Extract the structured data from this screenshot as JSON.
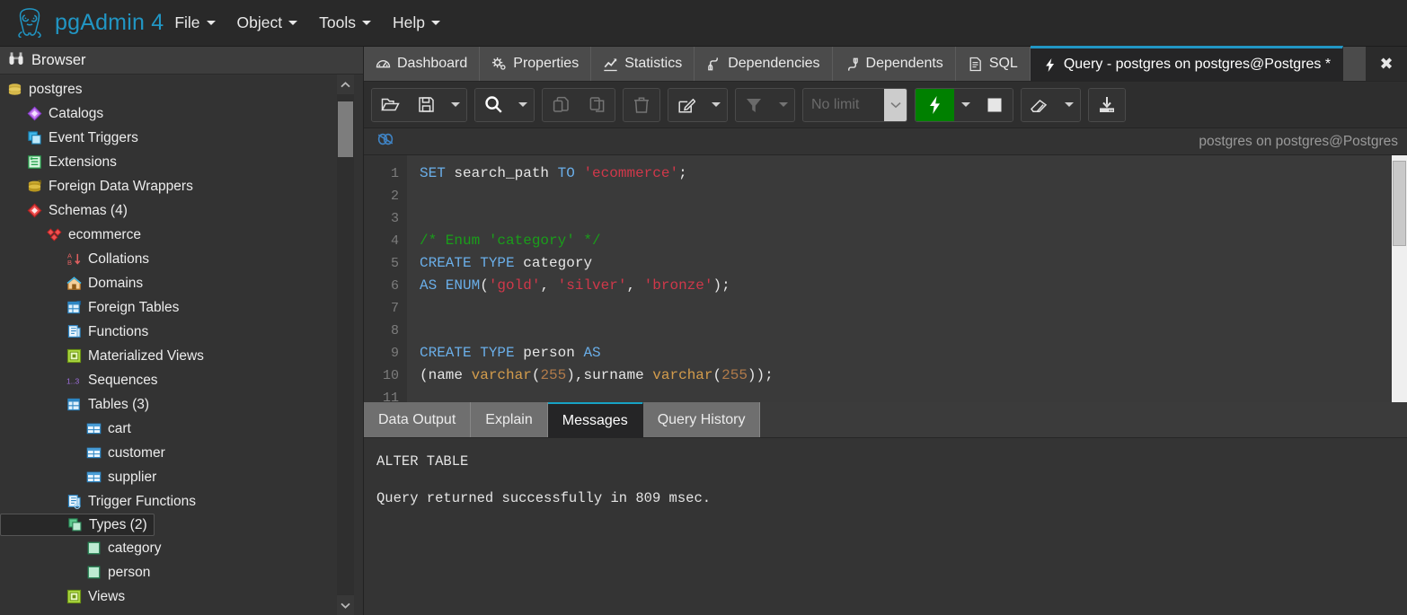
{
  "app": {
    "brand": "pgAdmin 4",
    "logo_icon": "postgresql-elephant-icon",
    "accent_color": "#2196c4",
    "execute_color": "#008000"
  },
  "menubar": {
    "items": [
      {
        "label": "File",
        "icon": "chevron-down-icon"
      },
      {
        "label": "Object",
        "icon": "chevron-down-icon"
      },
      {
        "label": "Tools",
        "icon": "chevron-down-icon"
      },
      {
        "label": "Help",
        "icon": "chevron-down-icon"
      }
    ]
  },
  "browser": {
    "header_label": "Browser",
    "header_icon": "binoculars-icon",
    "scrollbar": {
      "up_icon": "chevron-up-icon",
      "down_icon": "chevron-down-icon"
    },
    "tree": [
      {
        "label": "postgres",
        "icon": "database-icon",
        "depth": 0,
        "selected": false
      },
      {
        "label": "Catalogs",
        "icon": "catalog-diamond-icon",
        "depth": 1,
        "selected": false
      },
      {
        "label": "Event Triggers",
        "icon": "event-trigger-icon",
        "depth": 1,
        "selected": false
      },
      {
        "label": "Extensions",
        "icon": "extension-icon",
        "depth": 1,
        "selected": false
      },
      {
        "label": "Foreign Data Wrappers",
        "icon": "foreign-data-wrapper-icon",
        "depth": 1,
        "selected": false
      },
      {
        "label": "Schemas (4)",
        "icon": "schemas-diamond-icon",
        "depth": 1,
        "selected": false
      },
      {
        "label": "ecommerce",
        "icon": "schema-icon",
        "depth": 2,
        "selected": false
      },
      {
        "label": "Collations",
        "icon": "collation-icon",
        "depth": 3,
        "selected": false
      },
      {
        "label": "Domains",
        "icon": "domain-icon",
        "depth": 3,
        "selected": false
      },
      {
        "label": "Foreign Tables",
        "icon": "foreign-table-icon",
        "depth": 3,
        "selected": false
      },
      {
        "label": "Functions",
        "icon": "function-icon",
        "depth": 3,
        "selected": false
      },
      {
        "label": "Materialized Views",
        "icon": "materialized-view-icon",
        "depth": 3,
        "selected": false
      },
      {
        "label": "Sequences",
        "icon": "sequence-icon",
        "depth": 3,
        "selected": false
      },
      {
        "label": "Tables (3)",
        "icon": "tables-icon",
        "depth": 3,
        "selected": false
      },
      {
        "label": "cart",
        "icon": "table-icon",
        "depth": 4,
        "selected": false
      },
      {
        "label": "customer",
        "icon": "table-icon",
        "depth": 4,
        "selected": false
      },
      {
        "label": "supplier",
        "icon": "table-icon",
        "depth": 4,
        "selected": false
      },
      {
        "label": "Trigger Functions",
        "icon": "trigger-function-icon",
        "depth": 3,
        "selected": false
      },
      {
        "label": "Types (2)",
        "icon": "types-icon",
        "depth": 3,
        "selected": true
      },
      {
        "label": "category",
        "icon": "type-icon",
        "depth": 4,
        "selected": false
      },
      {
        "label": "person",
        "icon": "type-icon",
        "depth": 4,
        "selected": false
      },
      {
        "label": "Views",
        "icon": "view-icon",
        "depth": 3,
        "selected": false
      }
    ]
  },
  "dock": {
    "tabs": [
      {
        "label": "Dashboard",
        "icon": "dashboard-icon",
        "active": false
      },
      {
        "label": "Properties",
        "icon": "gear-icon",
        "active": false
      },
      {
        "label": "Statistics",
        "icon": "chart-line-icon",
        "active": false
      },
      {
        "label": "Dependencies",
        "icon": "dependencies-icon",
        "active": false
      },
      {
        "label": "Dependents",
        "icon": "dependents-icon",
        "active": false
      },
      {
        "label": "SQL",
        "icon": "sql-file-icon",
        "active": false
      },
      {
        "label": "Query - postgres on postgres@Postgres *",
        "icon": "lightning-icon",
        "active": true
      }
    ],
    "close_label": "✖",
    "close_icon": "close-icon"
  },
  "query_toolbar": {
    "groups": [
      {
        "buttons": [
          {
            "icon": "open-file-icon",
            "disabled": false,
            "dropdown": false
          },
          {
            "icon": "save-icon",
            "disabled": false,
            "dropdown": false
          },
          {
            "icon": "chevron-down-icon",
            "disabled": false,
            "dropdown": true
          }
        ]
      },
      {
        "buttons": [
          {
            "icon": "search-icon",
            "disabled": false,
            "dropdown": false
          },
          {
            "icon": "chevron-down-icon",
            "disabled": false,
            "dropdown": true
          }
        ]
      },
      {
        "buttons": [
          {
            "icon": "copy-icon",
            "disabled": true,
            "dropdown": false
          },
          {
            "icon": "paste-icon",
            "disabled": true,
            "dropdown": false
          }
        ]
      },
      {
        "buttons": [
          {
            "icon": "trash-icon",
            "disabled": true,
            "dropdown": false
          }
        ]
      },
      {
        "buttons": [
          {
            "icon": "edit-pencil-icon",
            "disabled": false,
            "dropdown": false
          },
          {
            "icon": "chevron-down-icon",
            "disabled": false,
            "dropdown": true
          }
        ]
      },
      {
        "buttons": [
          {
            "icon": "filter-funnel-icon",
            "disabled": true,
            "dropdown": false
          },
          {
            "icon": "chevron-down-icon",
            "disabled": true,
            "dropdown": true
          }
        ]
      }
    ],
    "row_limit": {
      "value": "",
      "placeholder": "No limit",
      "dropdown_icon": "chevron-down-icon"
    },
    "execute": {
      "icon": "lightning-bolt-icon",
      "dropdown_icon": "chevron-down-icon"
    },
    "stop": {
      "icon": "stop-square-icon"
    },
    "clear": {
      "icon": "eraser-icon",
      "dropdown_icon": "chevron-down-icon"
    },
    "download": {
      "icon": "download-icon"
    }
  },
  "connection_bar": {
    "link_icon": "connected-link-icon",
    "connection": "postgres on postgres@Postgres"
  },
  "editor": {
    "line_numbers": [
      "1",
      "2",
      "3",
      "4",
      "5",
      "6",
      "7",
      "8",
      "9",
      "10",
      "11"
    ],
    "lines": [
      [
        {
          "t": "SET",
          "c": "kw"
        },
        {
          "t": " search_path ",
          "c": "pl"
        },
        {
          "t": "TO",
          "c": "kw"
        },
        {
          "t": " ",
          "c": "pl"
        },
        {
          "t": "'ecommerce'",
          "c": "str"
        },
        {
          "t": ";",
          "c": "pl"
        }
      ],
      [],
      [],
      [
        {
          "t": "/* Enum 'category' */",
          "c": "cmt"
        }
      ],
      [
        {
          "t": "CREATE TYPE",
          "c": "kw"
        },
        {
          "t": " category",
          "c": "pl"
        }
      ],
      [
        {
          "t": "AS ENUM",
          "c": "kw"
        },
        {
          "t": "(",
          "c": "pl"
        },
        {
          "t": "'gold'",
          "c": "str"
        },
        {
          "t": ", ",
          "c": "pl"
        },
        {
          "t": "'silver'",
          "c": "str"
        },
        {
          "t": ", ",
          "c": "pl"
        },
        {
          "t": "'bronze'",
          "c": "str"
        },
        {
          "t": ");",
          "c": "pl"
        }
      ],
      [],
      [],
      [
        {
          "t": "CREATE TYPE",
          "c": "kw"
        },
        {
          "t": " person ",
          "c": "pl"
        },
        {
          "t": "AS",
          "c": "kw"
        }
      ],
      [
        {
          "t": "(name ",
          "c": "pl"
        },
        {
          "t": "varchar",
          "c": "typ"
        },
        {
          "t": "(",
          "c": "pl"
        },
        {
          "t": "255",
          "c": "num"
        },
        {
          "t": ")",
          "c": "pl"
        },
        {
          "t": ",surname ",
          "c": "pl"
        },
        {
          "t": "varchar",
          "c": "typ"
        },
        {
          "t": "(",
          "c": "pl"
        },
        {
          "t": "255",
          "c": "num"
        },
        {
          "t": "));",
          "c": "pl"
        }
      ],
      []
    ],
    "plain_text": "SET search_path TO 'ecommerce';\n\n\n/* Enum 'category' */\nCREATE TYPE category\nAS ENUM('gold', 'silver', 'bronze');\n\n\nCREATE TYPE person AS\n(name varchar(255),surname varchar(255));\n"
  },
  "results": {
    "tabs": [
      {
        "label": "Data Output",
        "active": false
      },
      {
        "label": "Explain",
        "active": false
      },
      {
        "label": "Messages",
        "active": true
      },
      {
        "label": "Query History",
        "active": false
      }
    ],
    "messages": [
      "ALTER TABLE",
      "",
      "Query returned successfully in 809 msec."
    ]
  }
}
